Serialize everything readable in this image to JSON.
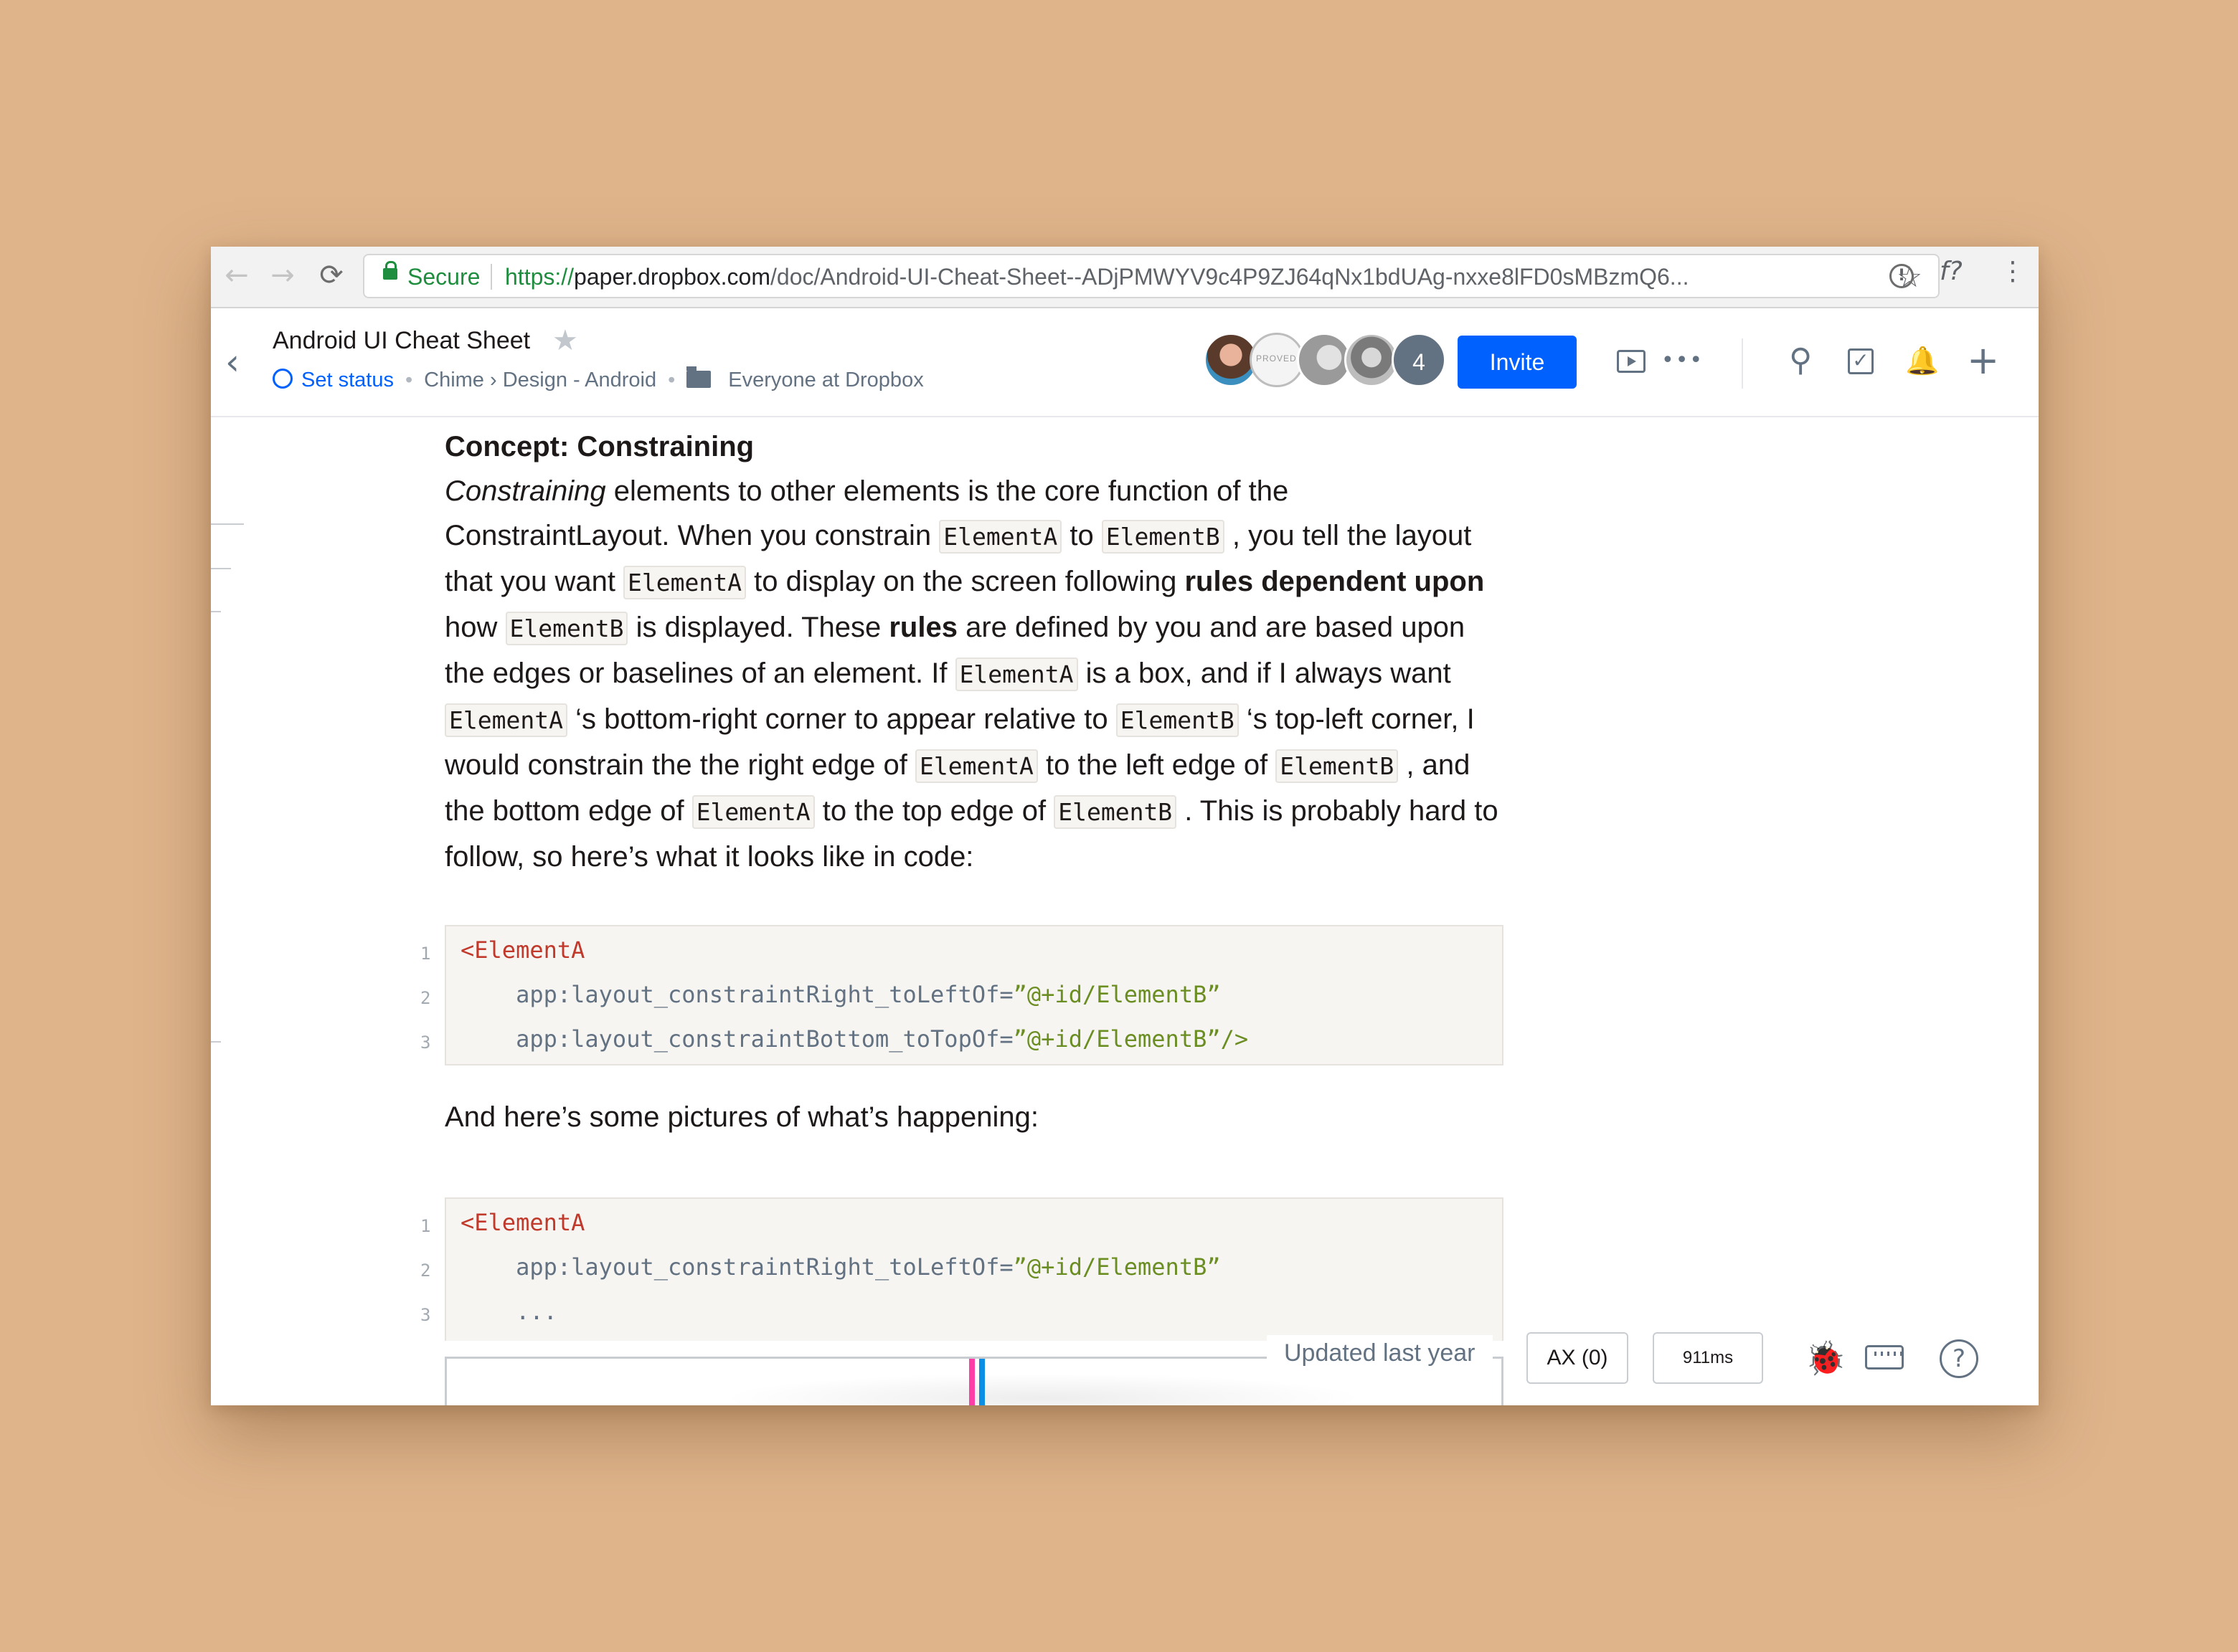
{
  "browser": {
    "back_icon": "←",
    "forward_icon": "→",
    "reload_icon": "⟳",
    "secure_label": "Secure",
    "url_scheme": "https://",
    "url_host": "paper.dropbox.com",
    "url_path": "/doc/Android-UI-Cheat-Sheet--ADjPMWYV9c4P9ZJ64qNx1bdUAg-nxxe8lFD0sMBzmQ6...",
    "bookmark_star": "☆",
    "ext_info_icon": "!",
    "ext_formula_icon": "f?",
    "menu_icon": "⋮"
  },
  "header": {
    "back_icon": "‹",
    "title": "Android UI Cheat Sheet",
    "star": "★",
    "set_status": "Set status",
    "breadcrumb": "Chime › Design - Android",
    "sharing": "Everyone at Dropbox",
    "collaborator_count": "4",
    "invite_label": "Invite",
    "more_icon": "•••",
    "search_icon": "⚲",
    "check_icon": "✓",
    "bell_icon": "🔔",
    "add_icon": "+"
  },
  "doc": {
    "heading": "Concept: Constraining",
    "para": {
      "constraining_em": "Constraining",
      "s1": " elements to other elements is the core function of the ConstraintLayout. When you constrain ",
      "elementA": "ElementA",
      "to": " to ",
      "elementB": "ElementB",
      "s2": " , you tell the layout that you want ",
      "s3": "  to display on the screen following ",
      "rules_dependent": "rules dependent upon",
      "how": " how ",
      "s4": " is displayed. These ",
      "rules": "rules",
      "s5": " are defined by you and are based upon the edges or baselines of an element. If ",
      "s6": " is a box, and if I always want ",
      "s7": " ‘s bottom-right corner to appear relative to ",
      "s8": " ‘s top-left corner, I would constrain the the right edge of ",
      "s9": "  to the left edge of ",
      "s10": " , and the bottom edge of ",
      "s11": " to the top edge of ",
      "s12": " . This is probably hard to follow, so here’s what it looks like in code:"
    },
    "code1": [
      {
        "num": "1",
        "tag": "<ElementA",
        "attr": "",
        "str": ""
      },
      {
        "num": "2",
        "tag": "",
        "attr": "    app:layout_constraintRight_toLeftOf=",
        "str": "”@+id/ElementB”"
      },
      {
        "num": "3",
        "tag": "",
        "attr": "    app:layout_constraintBottom_toTopOf=",
        "str": "”@+id/ElementB”/>"
      }
    ],
    "happening": "And here’s some pictures of what’s happening:",
    "code2": [
      {
        "num": "1",
        "tag": "<ElementA",
        "attr": "",
        "str": ""
      },
      {
        "num": "2",
        "tag": "",
        "attr": "    app:layout_constraintRight_toLeftOf=",
        "str": "”@+id/ElementB”"
      },
      {
        "num": "3",
        "tag": "",
        "attr": "    ...",
        "str": ""
      }
    ]
  },
  "footer": {
    "updated": "Updated last year",
    "ax_label": "AX (0)",
    "ms_label": "911ms",
    "bug_icon": "🐞",
    "help_icon": "?"
  },
  "colors": {
    "background": "#dfb48b",
    "accent": "#0061fe",
    "secure_green": "#1e8e3e",
    "code_tag": "#c0392b",
    "code_string": "#6b8e23"
  }
}
